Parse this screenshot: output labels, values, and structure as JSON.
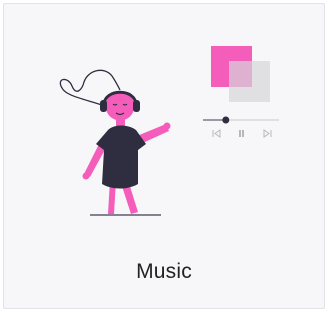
{
  "card": {
    "title": "Music"
  },
  "illustration": {
    "accent_color": "#f55dbb",
    "dark_color": "#2f2e41",
    "secondary_square_color": "#e0e0e0",
    "icons": [
      "headphones-icon",
      "album-art-icon",
      "previous-icon",
      "pause-icon",
      "next-icon"
    ]
  },
  "player": {
    "progress": 0.3
  }
}
